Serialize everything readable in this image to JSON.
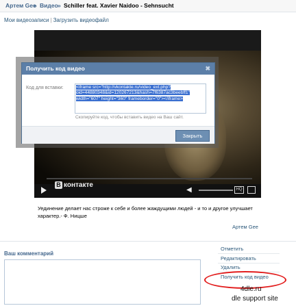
{
  "breadcrumb": {
    "user": "Артем Gee",
    "sep": "»",
    "section": "Видео",
    "title": "Schiller feat. Xavier Naidoo - Sehnsucht"
  },
  "sublinks": {
    "my_videos": "Мои видеозаписи",
    "separator": "|",
    "upload": "Загрузить видеофайл"
  },
  "player": {
    "logo_letter": "В",
    "logo_text": "контакте"
  },
  "dialog": {
    "title": "Получить код видео",
    "close": "✖",
    "label": "Код для вставки:",
    "code": "<iframe src=\"http://vkontakte.ru/video_ext.php?oid=44880348&id=120267213&hash=7f6387ac3beebff1\" width=\"607\" height=\"360\" frameborder=\"0\"></iframe>",
    "hint": "Скопируйте код, чтобы вставить видео на Ваш сайт.",
    "close_button": "Закрыть"
  },
  "description": "Уединение делает нас строже к себе и более жаждущими людей - и то и другое улучшает характер.- Ф. Ницше",
  "author": "Артем Gee",
  "comment": {
    "heading": "Ваш комментарий"
  },
  "actions": {
    "mark": "Отметить",
    "edit": "Редактировать",
    "delete": "Удалить",
    "get_code": "Получить код видео"
  },
  "watermark": {
    "line1": "4dle.ru",
    "line2": "dle support site"
  },
  "colors": {
    "link": "#2b587a",
    "accent": "#5c7fa8",
    "highlight_oval": "#e21c1c"
  }
}
